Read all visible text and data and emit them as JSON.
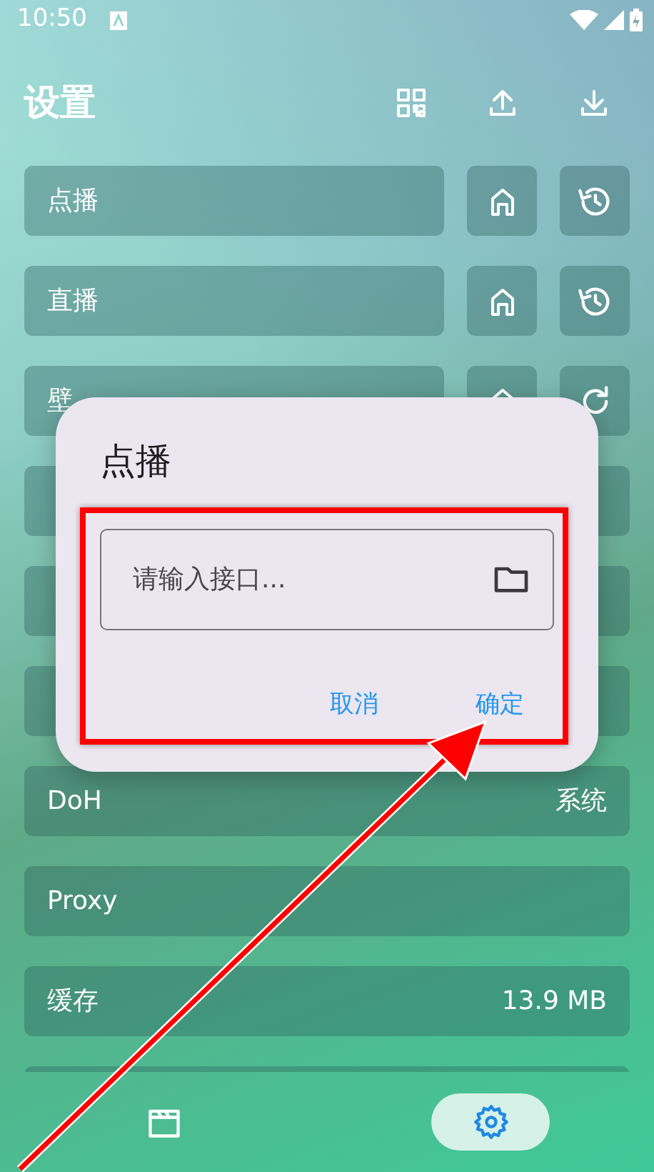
{
  "status_bar": {
    "time": "10:50"
  },
  "header": {
    "title": "设置"
  },
  "rows": [
    {
      "kind": "source",
      "label": "点播"
    },
    {
      "kind": "source",
      "label": "直播"
    },
    {
      "kind": "wallpaper",
      "label": "壁"
    },
    {
      "kind": "setting"
    },
    {
      "kind": "setting"
    },
    {
      "kind": "setting"
    },
    {
      "kind": "setting",
      "label": "DoH",
      "value": "系统"
    },
    {
      "kind": "setting",
      "label": "Proxy"
    },
    {
      "kind": "setting",
      "label": "缓存",
      "value": "13.9 MB"
    },
    {
      "kind": "setting"
    }
  ],
  "dialog": {
    "title": "点播",
    "input": {
      "placeholder": "请输入接口..."
    },
    "buttons": [
      "取消",
      "确定"
    ]
  },
  "bottom_nav": [
    {
      "kind": "videos",
      "selected": false
    },
    {
      "kind": "settings",
      "selected": true
    }
  ]
}
